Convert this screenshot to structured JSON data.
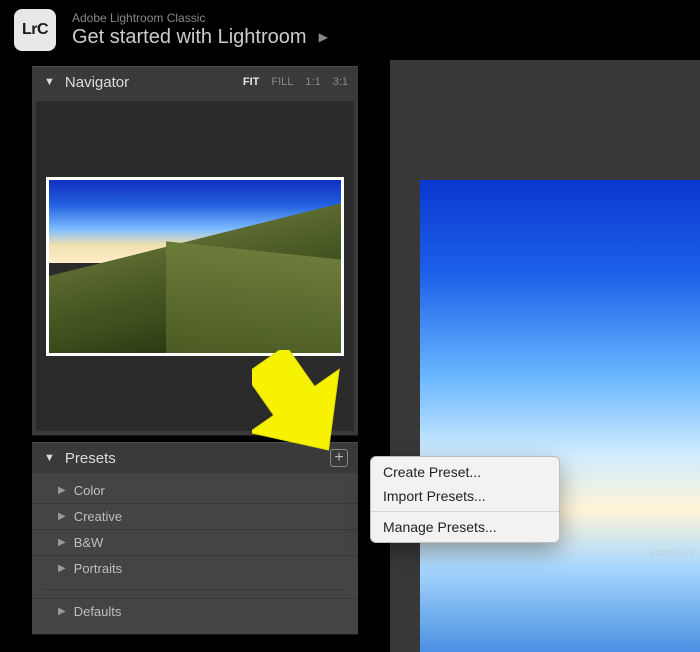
{
  "header": {
    "app_icon_text": "LrC",
    "app_title": "Adobe Lightroom Classic",
    "get_started": "Get started with Lightroom"
  },
  "navigator": {
    "title": "Navigator",
    "modes": {
      "fit": "FIT",
      "fill": "FILL",
      "one_to_one": "1:1",
      "three_to_one": "3:1"
    }
  },
  "presets": {
    "title": "Presets",
    "groups": [
      "Color",
      "Creative",
      "B&W",
      "Portraits"
    ],
    "defaults_label": "Defaults"
  },
  "context_menu": {
    "create": "Create Preset...",
    "import": "Import Presets...",
    "manage": "Manage Presets..."
  }
}
